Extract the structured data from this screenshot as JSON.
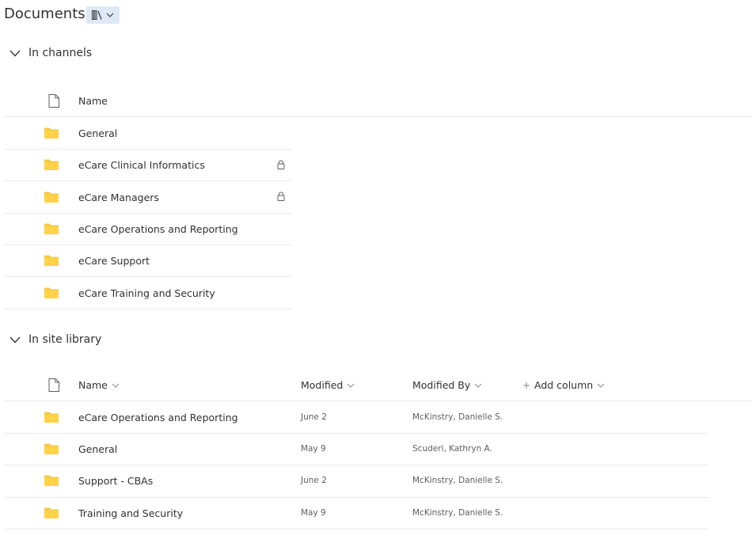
{
  "header": {
    "title": "Documents"
  },
  "channels": {
    "section_label": "In channels",
    "column_name": "Name",
    "rows": [
      {
        "name": "General",
        "locked": false
      },
      {
        "name": "eCare Clinical Informatics",
        "locked": true
      },
      {
        "name": "eCare Managers",
        "locked": true
      },
      {
        "name": "eCare Operations and Reporting",
        "locked": false
      },
      {
        "name": "eCare Support",
        "locked": false
      },
      {
        "name": "eCare Training and Security",
        "locked": false
      }
    ]
  },
  "library": {
    "section_label": "In site library",
    "columns": {
      "name": "Name",
      "modified": "Modified",
      "modified_by": "Modified By",
      "add_column": "Add column"
    },
    "rows": [
      {
        "name": "eCare Operations and Reporting",
        "modified": "June 2",
        "modified_by": "McKinstry, Danielle S."
      },
      {
        "name": "General",
        "modified": "May 9",
        "modified_by": "Scuderi, Kathryn A."
      },
      {
        "name": "Support - CBAs",
        "modified": "June 2",
        "modified_by": "McKinstry, Danielle S."
      },
      {
        "name": "Training and Security",
        "modified": "May 9",
        "modified_by": "McKinstry, Danielle S."
      }
    ]
  },
  "colors": {
    "folder": "#f4c944",
    "divider": "#edebe9",
    "library_button_bg": "#dde9f6"
  },
  "icons": {
    "folder": "folder-icon",
    "lock": "lock-icon",
    "file": "file-type-icon",
    "chevron": "chevron-down-icon",
    "library": "library-icon",
    "plus": "plus-icon"
  }
}
